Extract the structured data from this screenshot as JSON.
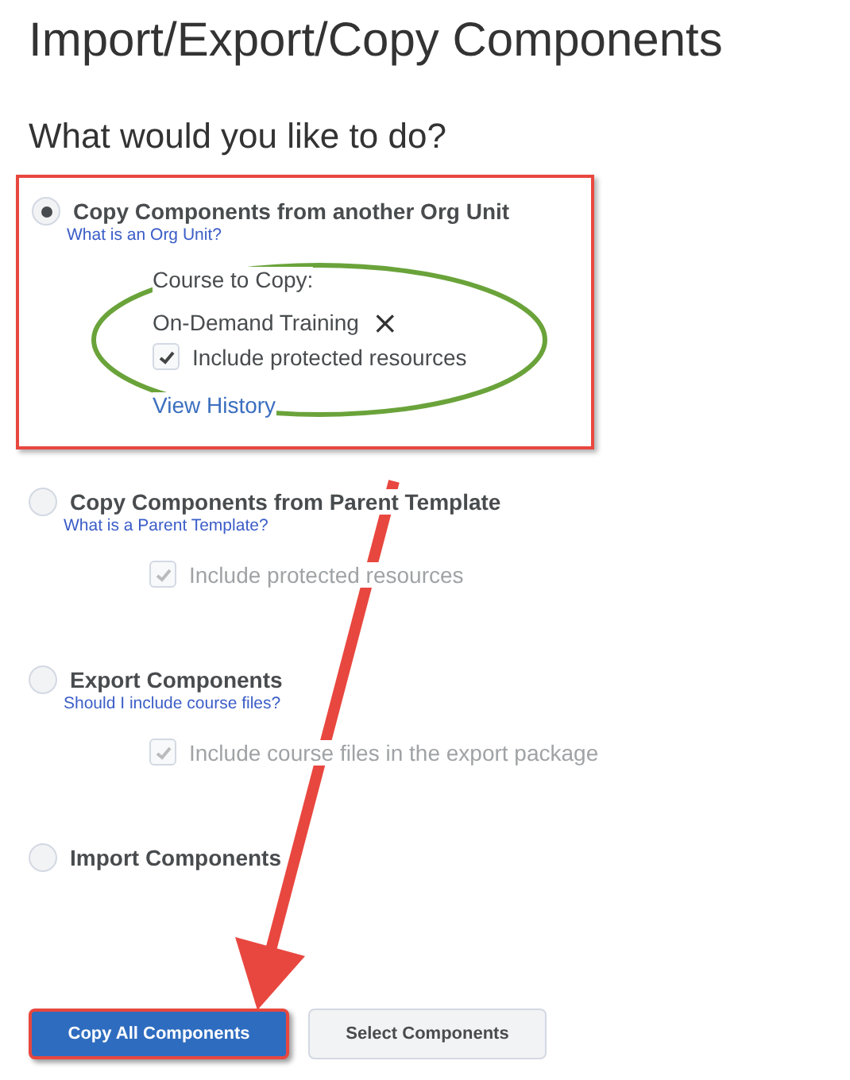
{
  "title": "Import/Export/Copy Components",
  "question": "What would you like to do?",
  "options": [
    {
      "label": "Copy Components from another Org Unit",
      "selected": true,
      "help_link": "What is an Org Unit?",
      "course_label": "Course to Copy:",
      "course_value": "On-Demand Training",
      "remove_icon": "×",
      "checkbox": {
        "label": "Include protected resources",
        "checked": true,
        "disabled": false
      },
      "history_link": "View History"
    },
    {
      "label": "Copy Components from Parent Template",
      "selected": false,
      "help_link": "What is a Parent Template?",
      "checkbox": {
        "label": "Include protected resources",
        "checked": true,
        "disabled": true
      }
    },
    {
      "label": "Export Components",
      "selected": false,
      "help_link": "Should I include course files?",
      "checkbox": {
        "label": "Include course files in the export package",
        "checked": true,
        "disabled": true
      }
    },
    {
      "label": "Import Components",
      "selected": false
    }
  ],
  "buttons": [
    {
      "label": "Copy All Components",
      "kind": "primary"
    },
    {
      "label": "Select Components",
      "kind": "secondary"
    }
  ]
}
